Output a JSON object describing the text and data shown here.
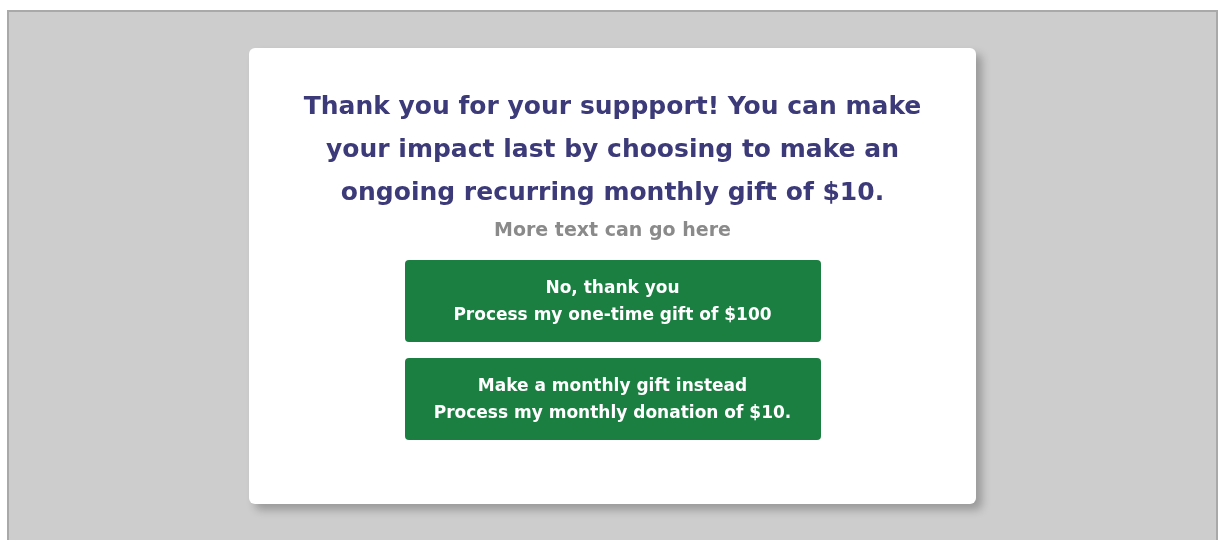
{
  "dialog": {
    "heading": "Thank you for your suppport! You can make your impact last by choosing to make an ongoing recurring monthly gift of $10.",
    "subtext": "More text can go here",
    "buttons": [
      {
        "lines": [
          "No, thank you",
          "Process my one-time gift of $100"
        ]
      },
      {
        "lines": [
          "Make a monthly gift instead",
          "Process my monthly donation of $10."
        ]
      }
    ]
  }
}
